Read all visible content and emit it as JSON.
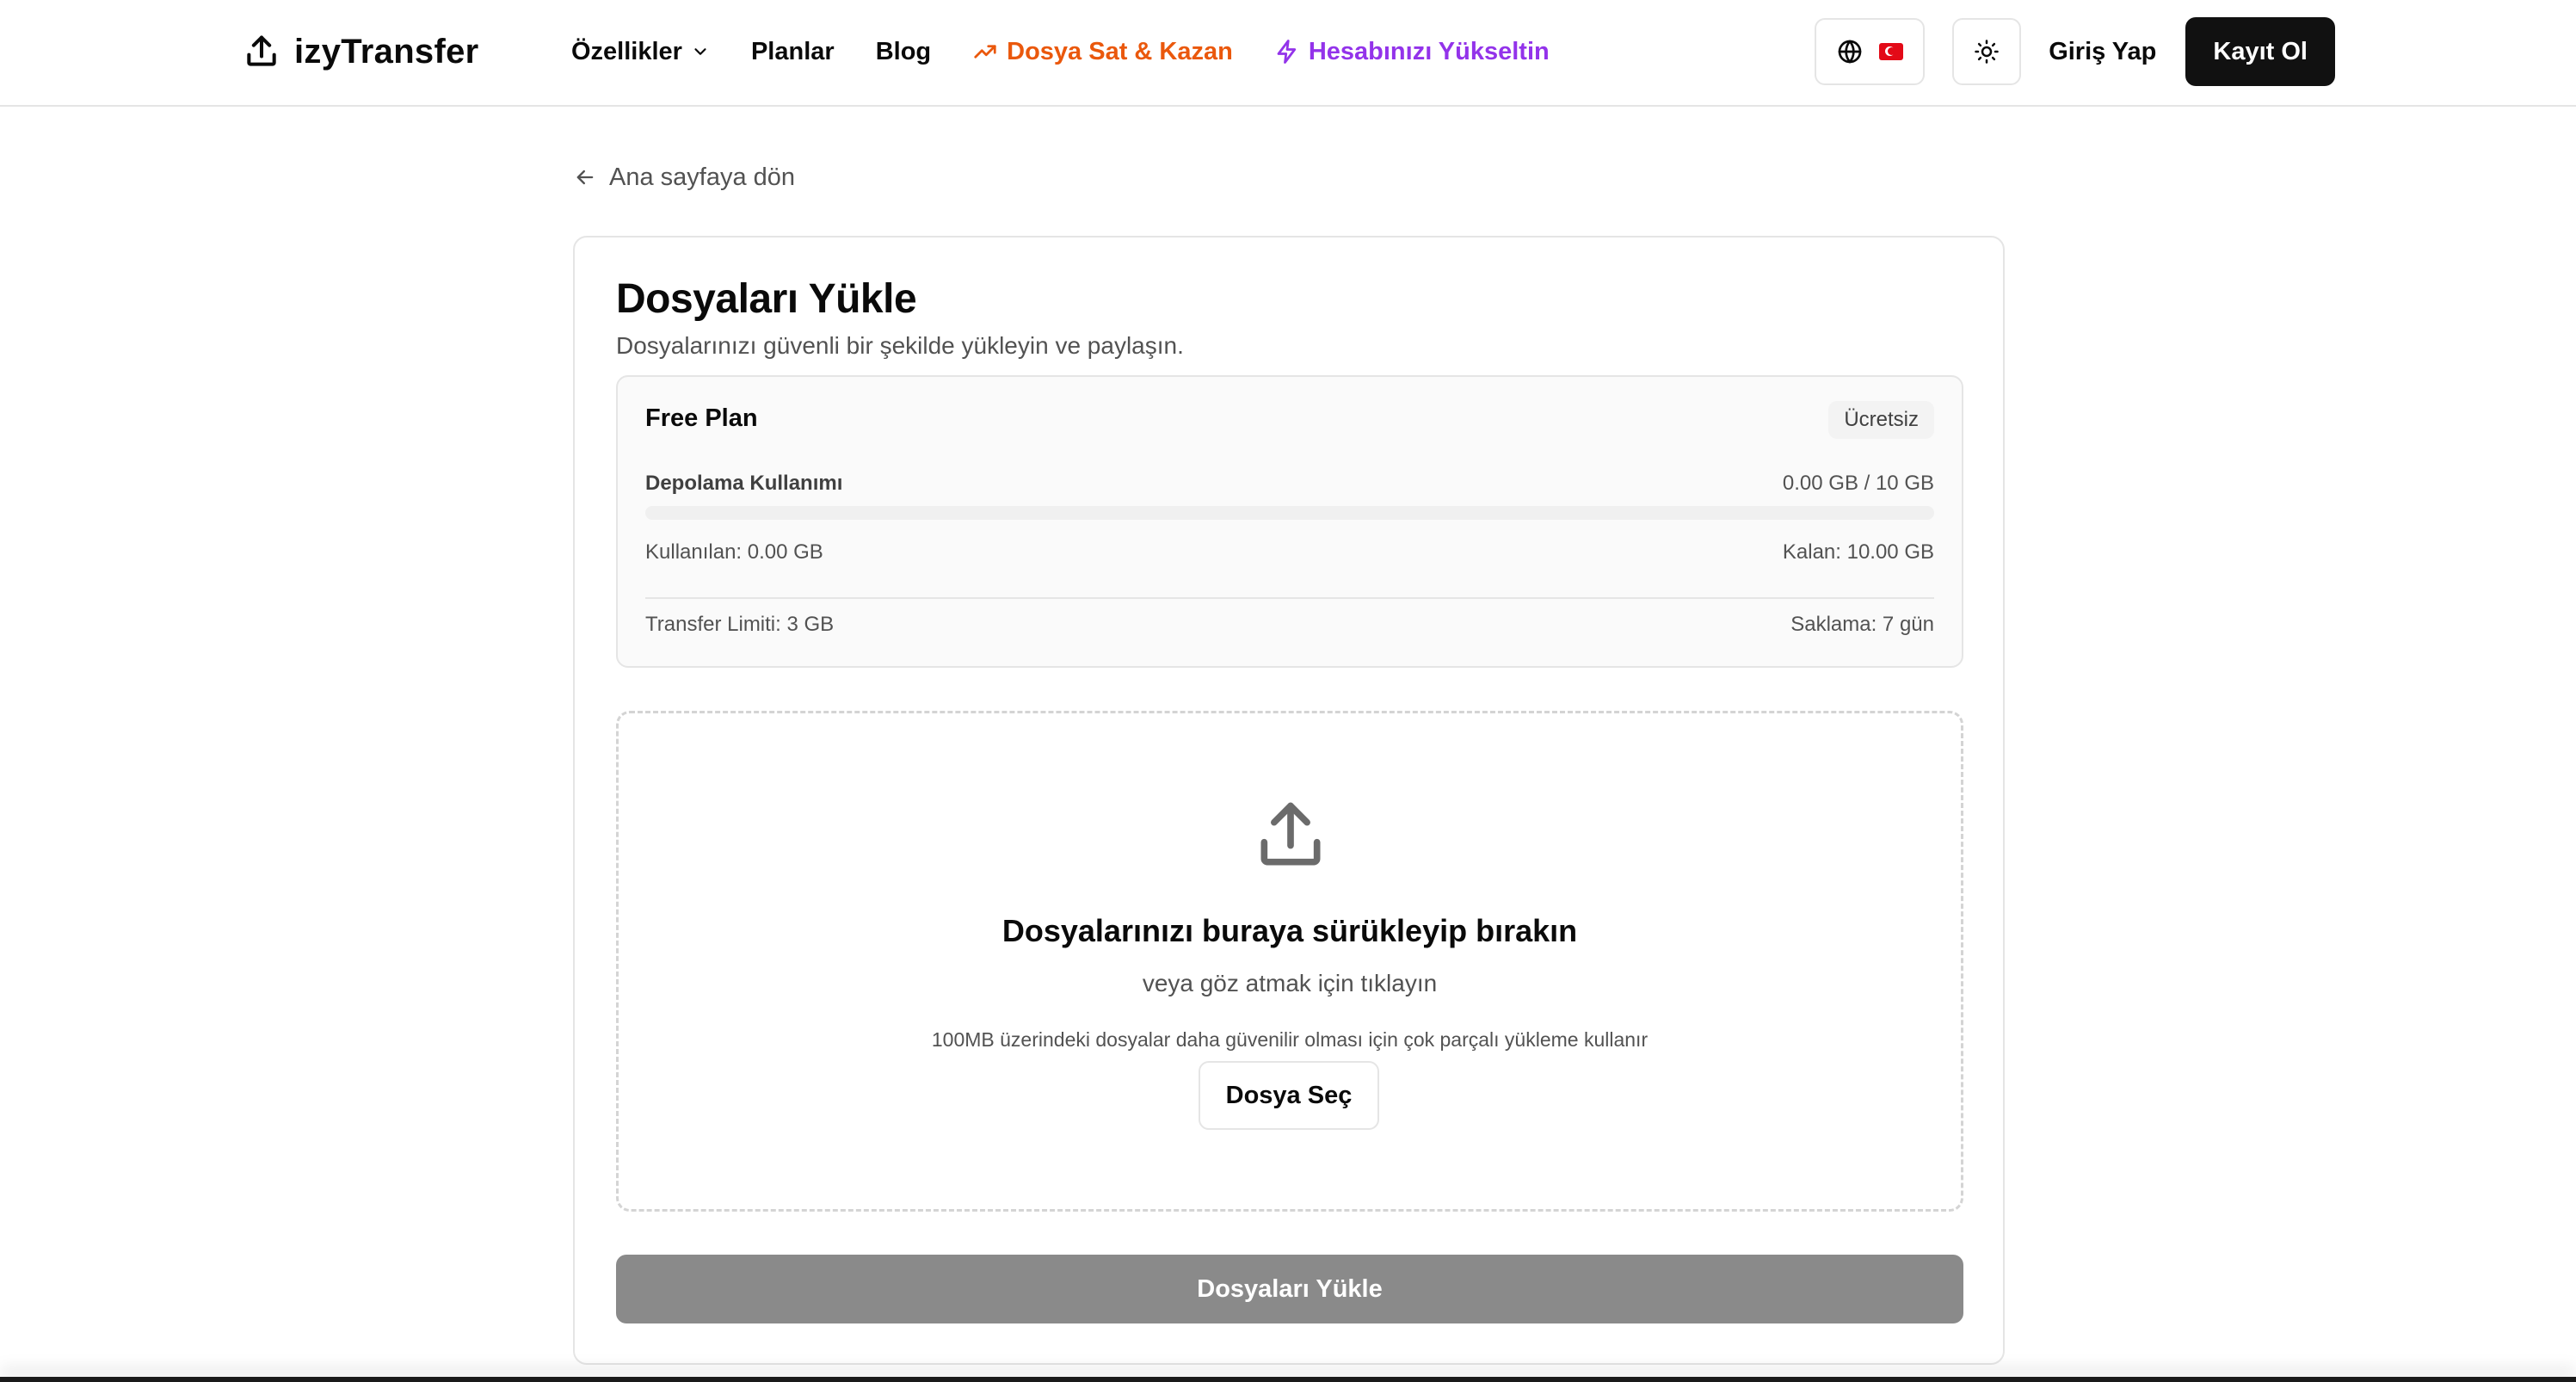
{
  "app": {
    "name": "izyTransfer"
  },
  "nav": {
    "features": "Özellikler",
    "plans": "Planlar",
    "blog": "Blog",
    "sell_earn": "Dosya Sat & Kazan",
    "upgrade": "Hesabınızı Yükseltin"
  },
  "header": {
    "login": "Giriş Yap",
    "signup": "Kayıt Ol",
    "language_flag": "tr"
  },
  "back": {
    "label": "Ana sayfaya dön"
  },
  "upload": {
    "title": "Dosyaları Yükle",
    "subtitle": "Dosyalarınızı güvenli bir şekilde yükleyin ve paylaşın.",
    "plan": {
      "name": "Free Plan",
      "badge": "Ücretsiz",
      "storage_label": "Depolama Kullanımı",
      "storage_value": "0.00 GB / 10 GB",
      "usage_fraction": 0,
      "used": "Kullanılan: 0.00 GB",
      "remaining": "Kalan: 10.00 GB",
      "transfer_limit": "Transfer Limiti: 3 GB",
      "retention": "Saklama: 7 gün"
    },
    "dropzone": {
      "title": "Dosyalarınızı buraya sürükleyip bırakın",
      "subtitle": "veya göz atmak için tıklayın",
      "note": "100MB üzerindeki dosyalar daha güvenilir olması için çok parçalı yükleme kullanır",
      "select_button": "Dosya Seç"
    },
    "submit_button": "Dosyaları Yükle"
  },
  "colors": {
    "accent_orange": "#ea580c",
    "accent_purple": "#9333ea",
    "primary_dark": "#111111",
    "disabled_button": "#8a8a8a"
  },
  "icons": [
    "upload-icon",
    "chevron-down-icon",
    "trending-up-icon",
    "lightning-icon",
    "globe-icon",
    "sun-icon",
    "arrow-left-icon"
  ]
}
